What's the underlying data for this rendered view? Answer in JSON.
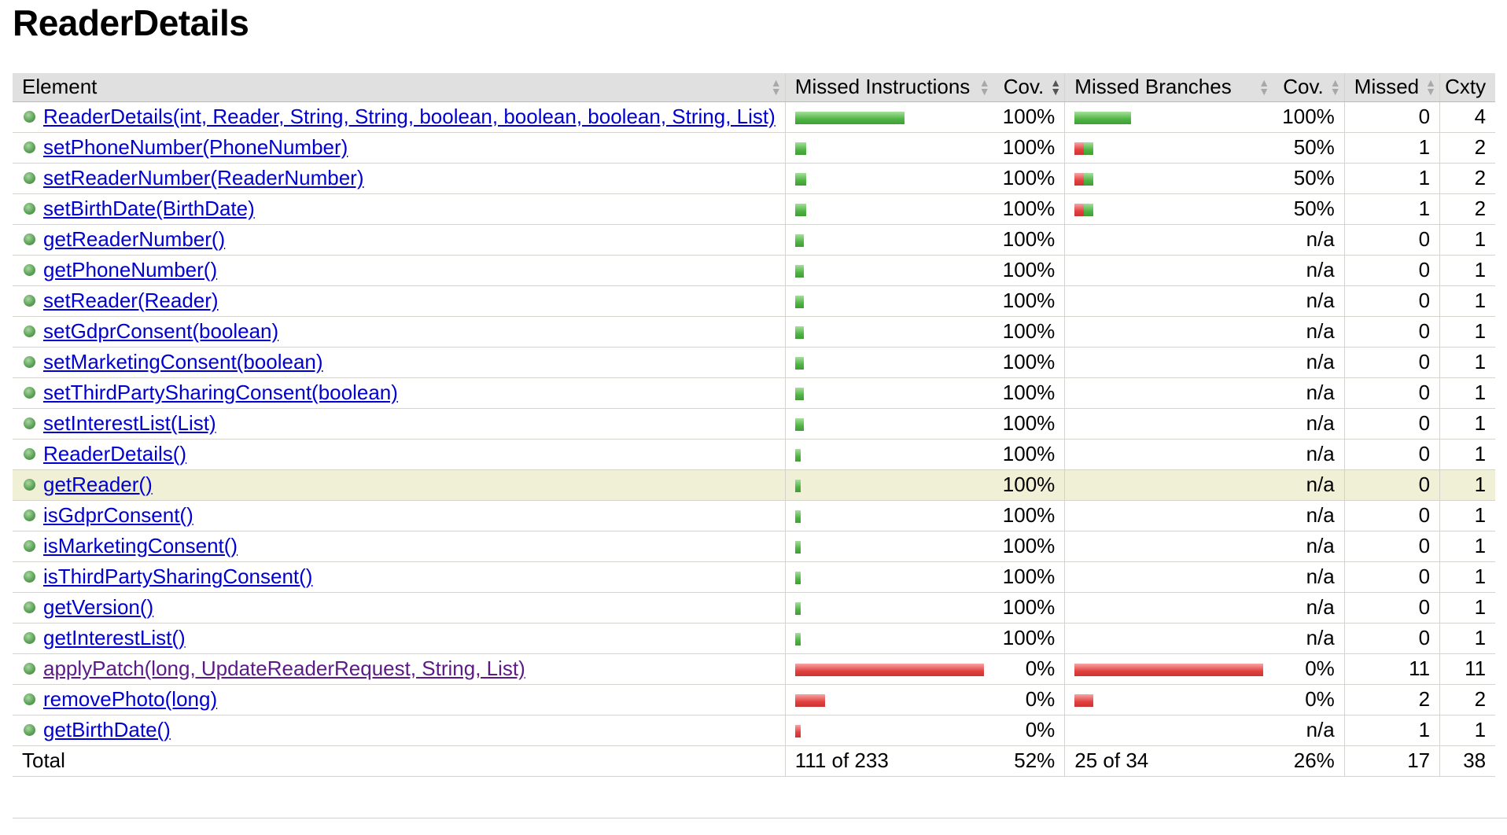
{
  "page": {
    "title": "ReaderDetails"
  },
  "columns": {
    "element": "Element",
    "missed_instructions": "Missed Instructions",
    "instr_cov": "Cov.",
    "missed_branches": "Missed Branches",
    "branch_cov": "Cov.",
    "missed": "Missed",
    "cxty": "Cxty"
  },
  "colors": {
    "covered": "#4fb443",
    "missed": "#e2413f",
    "link": "#0000d0",
    "highlight": "#f0f0d6"
  },
  "rows": [
    {
      "name": "ReaderDetails(int, Reader, String, String, boolean, boolean, boolean, String, List)",
      "instr_green": 0.58,
      "instr_red": 0,
      "instr_cov": "100%",
      "br_green": 0.3,
      "br_red": 0,
      "br_cov": "100%",
      "missed": "0",
      "cxty": "4"
    },
    {
      "name": "setPhoneNumber(PhoneNumber)",
      "instr_green": 0.06,
      "instr_red": 0,
      "instr_cov": "100%",
      "br_green": 0.05,
      "br_red": 0.05,
      "br_cov": "50%",
      "missed": "1",
      "cxty": "2"
    },
    {
      "name": "setReaderNumber(ReaderNumber)",
      "instr_green": 0.06,
      "instr_red": 0,
      "instr_cov": "100%",
      "br_green": 0.05,
      "br_red": 0.05,
      "br_cov": "50%",
      "missed": "1",
      "cxty": "2"
    },
    {
      "name": "setBirthDate(BirthDate)",
      "instr_green": 0.06,
      "instr_red": 0,
      "instr_cov": "100%",
      "br_green": 0.05,
      "br_red": 0.05,
      "br_cov": "50%",
      "missed": "1",
      "cxty": "2"
    },
    {
      "name": "getReaderNumber()",
      "instr_green": 0.045,
      "instr_red": 0,
      "instr_cov": "100%",
      "br_green": 0,
      "br_red": 0,
      "br_cov": "n/a",
      "missed": "0",
      "cxty": "1"
    },
    {
      "name": "getPhoneNumber()",
      "instr_green": 0.045,
      "instr_red": 0,
      "instr_cov": "100%",
      "br_green": 0,
      "br_red": 0,
      "br_cov": "n/a",
      "missed": "0",
      "cxty": "1"
    },
    {
      "name": "setReader(Reader)",
      "instr_green": 0.045,
      "instr_red": 0,
      "instr_cov": "100%",
      "br_green": 0,
      "br_red": 0,
      "br_cov": "n/a",
      "missed": "0",
      "cxty": "1"
    },
    {
      "name": "setGdprConsent(boolean)",
      "instr_green": 0.045,
      "instr_red": 0,
      "instr_cov": "100%",
      "br_green": 0,
      "br_red": 0,
      "br_cov": "n/a",
      "missed": "0",
      "cxty": "1"
    },
    {
      "name": "setMarketingConsent(boolean)",
      "instr_green": 0.045,
      "instr_red": 0,
      "instr_cov": "100%",
      "br_green": 0,
      "br_red": 0,
      "br_cov": "n/a",
      "missed": "0",
      "cxty": "1"
    },
    {
      "name": "setThirdPartySharingConsent(boolean)",
      "instr_green": 0.045,
      "instr_red": 0,
      "instr_cov": "100%",
      "br_green": 0,
      "br_red": 0,
      "br_cov": "n/a",
      "missed": "0",
      "cxty": "1"
    },
    {
      "name": "setInterestList(List)",
      "instr_green": 0.045,
      "instr_red": 0,
      "instr_cov": "100%",
      "br_green": 0,
      "br_red": 0,
      "br_cov": "n/a",
      "missed": "0",
      "cxty": "1"
    },
    {
      "name": "ReaderDetails()",
      "instr_green": 0.03,
      "instr_red": 0,
      "instr_cov": "100%",
      "br_green": 0,
      "br_red": 0,
      "br_cov": "n/a",
      "missed": "0",
      "cxty": "1"
    },
    {
      "name": "getReader()",
      "instr_green": 0.03,
      "instr_red": 0,
      "instr_cov": "100%",
      "br_green": 0,
      "br_red": 0,
      "br_cov": "n/a",
      "missed": "0",
      "cxty": "1",
      "highlight": true
    },
    {
      "name": "isGdprConsent()",
      "instr_green": 0.03,
      "instr_red": 0,
      "instr_cov": "100%",
      "br_green": 0,
      "br_red": 0,
      "br_cov": "n/a",
      "missed": "0",
      "cxty": "1"
    },
    {
      "name": "isMarketingConsent()",
      "instr_green": 0.03,
      "instr_red": 0,
      "instr_cov": "100%",
      "br_green": 0,
      "br_red": 0,
      "br_cov": "n/a",
      "missed": "0",
      "cxty": "1"
    },
    {
      "name": "isThirdPartySharingConsent()",
      "instr_green": 0.03,
      "instr_red": 0,
      "instr_cov": "100%",
      "br_green": 0,
      "br_red": 0,
      "br_cov": "n/a",
      "missed": "0",
      "cxty": "1"
    },
    {
      "name": "getVersion()",
      "instr_green": 0.03,
      "instr_red": 0,
      "instr_cov": "100%",
      "br_green": 0,
      "br_red": 0,
      "br_cov": "n/a",
      "missed": "0",
      "cxty": "1"
    },
    {
      "name": "getInterestList()",
      "instr_green": 0.03,
      "instr_red": 0,
      "instr_cov": "100%",
      "br_green": 0,
      "br_red": 0,
      "br_cov": "n/a",
      "missed": "0",
      "cxty": "1"
    },
    {
      "name": "applyPatch(long, UpdateReaderRequest, String, List)",
      "instr_green": 0,
      "instr_red": 1.0,
      "instr_cov": "0%",
      "br_green": 0,
      "br_red": 1.0,
      "br_cov": "0%",
      "missed": "11",
      "cxty": "11",
      "visited": true
    },
    {
      "name": "removePhoto(long)",
      "instr_green": 0,
      "instr_red": 0.16,
      "instr_cov": "0%",
      "br_green": 0,
      "br_red": 0.1,
      "br_cov": "0%",
      "missed": "2",
      "cxty": "2"
    },
    {
      "name": "getBirthDate()",
      "instr_green": 0,
      "instr_red": 0.03,
      "instr_cov": "0%",
      "br_green": 0,
      "br_red": 0,
      "br_cov": "n/a",
      "missed": "1",
      "cxty": "1"
    }
  ],
  "total": {
    "label": "Total",
    "missed_instructions": "111 of 233",
    "instr_cov": "52%",
    "missed_branches": "25 of 34",
    "branch_cov": "26%",
    "missed": "17",
    "cxty": "38"
  }
}
